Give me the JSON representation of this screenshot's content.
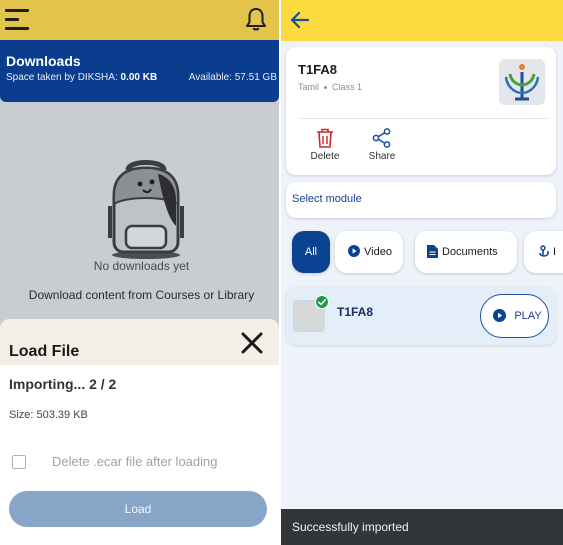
{
  "left_panel": {
    "header": {
      "menu_icon": "hamburger-menu-icon",
      "notifications_icon": "bell-icon"
    },
    "downloads": {
      "title": "Downloads",
      "space_label": "Space taken by DIKSHA:",
      "space_value": "0.00 KB",
      "available": "Available: 57.51 GB"
    },
    "empty_state": {
      "illustration_icon": "backpack-illustration",
      "message": "No downloads yet",
      "hint": "Download content from Courses or Library"
    },
    "load_sheet": {
      "title": "Load File",
      "close_icon": "close-icon",
      "status": "Importing... 2 / 2",
      "size": "Size: 503.39 KB",
      "checkbox_label": "Delete .ecar file after loading",
      "checkbox_checked": false,
      "button_label": "Load"
    }
  },
  "right_panel": {
    "header": {
      "back_icon": "back-arrow-icon"
    },
    "content": {
      "title": "T1FA8",
      "language": "Tamil",
      "class": "Class 1",
      "logo_icon": "diksha-logo",
      "actions": [
        {
          "label": "Delete",
          "icon": "trash-icon"
        },
        {
          "label": "Share",
          "icon": "share-icon"
        }
      ]
    },
    "module_selector": {
      "label": "Select module"
    },
    "filters": [
      {
        "label": "All",
        "selected": true
      },
      {
        "label": "Video",
        "icon": "play-circle-icon",
        "selected": false
      },
      {
        "label": "Documents",
        "icon": "document-icon",
        "selected": false
      },
      {
        "label": "I",
        "icon": "touch-icon",
        "selected": false
      }
    ],
    "item": {
      "title": "T1FA8",
      "downloaded": true,
      "play_label": "PLAY"
    },
    "snackbar": "Successfully imported"
  },
  "colors": {
    "left_header": "#e2c44a",
    "right_header": "#fbd93f",
    "downloads_bar": "#0b3d8f",
    "accent_blue": "#0a4391",
    "load_button": "#87a6c7",
    "success_green": "#1e9b47"
  }
}
